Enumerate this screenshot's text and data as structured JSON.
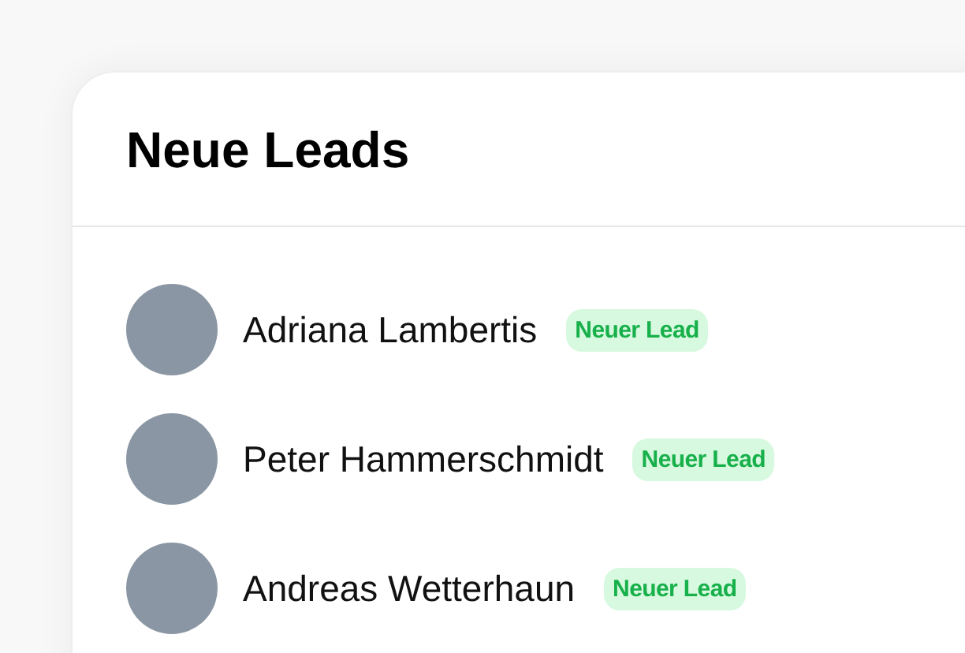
{
  "card": {
    "title": "Neue Leads"
  },
  "leads": [
    {
      "name": "Adriana Lambertis",
      "badge": "Neuer Lead"
    },
    {
      "name": "Peter Hammerschmidt",
      "badge": "Neuer Lead"
    },
    {
      "name": "Andreas Wetterhaun",
      "badge": "Neuer Lead"
    }
  ]
}
